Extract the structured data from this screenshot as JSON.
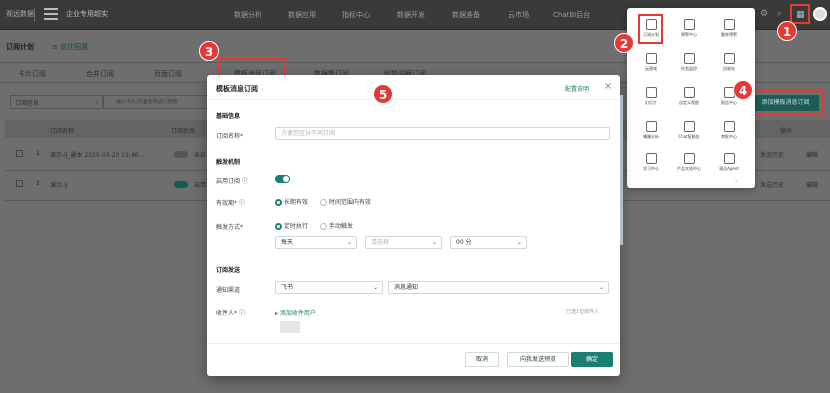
{
  "topbar": {
    "logo": "观远数据",
    "app_title": "企业专用超实",
    "nav": [
      "数据分析",
      "数据应用",
      "指标中心",
      "数据开发",
      "数据准备",
      "云市场",
      "ChatBI后台"
    ]
  },
  "page": {
    "title": "订阅计划",
    "subtitle": "≡ 前往配置",
    "tabs": [
      "卡片订阅",
      "合并订阅",
      "页面订阅",
      "模板消息订阅",
      "数据集订阅",
      "智能洞察订阅"
    ],
    "filter_select": "订阅信息",
    "search_placeholder": "输入卡片/页面名称进行搜索",
    "columns": [
      "订阅名称",
      "订阅状态",
      "操作"
    ],
    "rows": [
      {
        "num": "1",
        "name": "演示-ij_副本 2025-03-20 13:46...",
        "state": "未启",
        "actions": [
          "发送历史",
          "编辑"
        ]
      },
      {
        "num": "2",
        "name": "演示-ij",
        "state": "启用",
        "actions": [
          "发送历史",
          "编辑"
        ]
      }
    ],
    "add_template_button": "添加模板消息订阅"
  },
  "launcher": {
    "apps": [
      [
        "订阅计划",
        "预警中心",
        "题库预警"
      ],
      [
        "云观域",
        "任务监控",
        "回收站"
      ],
      [
        "幻灯片",
        "自定义视图",
        "报告中心"
      ],
      [
        "嘴嘴分析",
        "Chat智能佐",
        "审批中心"
      ],
      [
        "学习中心",
        "产品文档中心",
        "观远Agent"
      ]
    ]
  },
  "modal": {
    "title": "模板消息订阅",
    "help_link": "配置说明",
    "close": "×",
    "basic_section": "基础信息",
    "name_label": "订阅名称*",
    "name_placeholder": "方便您区分不同订阅",
    "trigger_section": "触发机制",
    "enable_label": "启用订阅 ⓘ",
    "validity_label": "有效期* ⓘ",
    "validity_options": [
      "长期有效",
      "时间范围内有效"
    ],
    "trigger_label": "触发方式*",
    "trigger_options": [
      "定时执行",
      "手动触发"
    ],
    "freq": "每天",
    "hour_placeholder": "请选择",
    "minute": "00 分",
    "send_section": "订阅发送",
    "channel_label": "通知渠道",
    "channel": "飞书",
    "msg_type": "消息通知",
    "recipient_label": "收件人* ⓘ",
    "add_recipient": "▸ 添加收件用户",
    "recipient_count": "已选1位收件人",
    "cancel": "取消",
    "send_preview": "向我发送预览",
    "confirm": "确定"
  },
  "badges": [
    "1",
    "2",
    "3",
    "4",
    "5"
  ]
}
